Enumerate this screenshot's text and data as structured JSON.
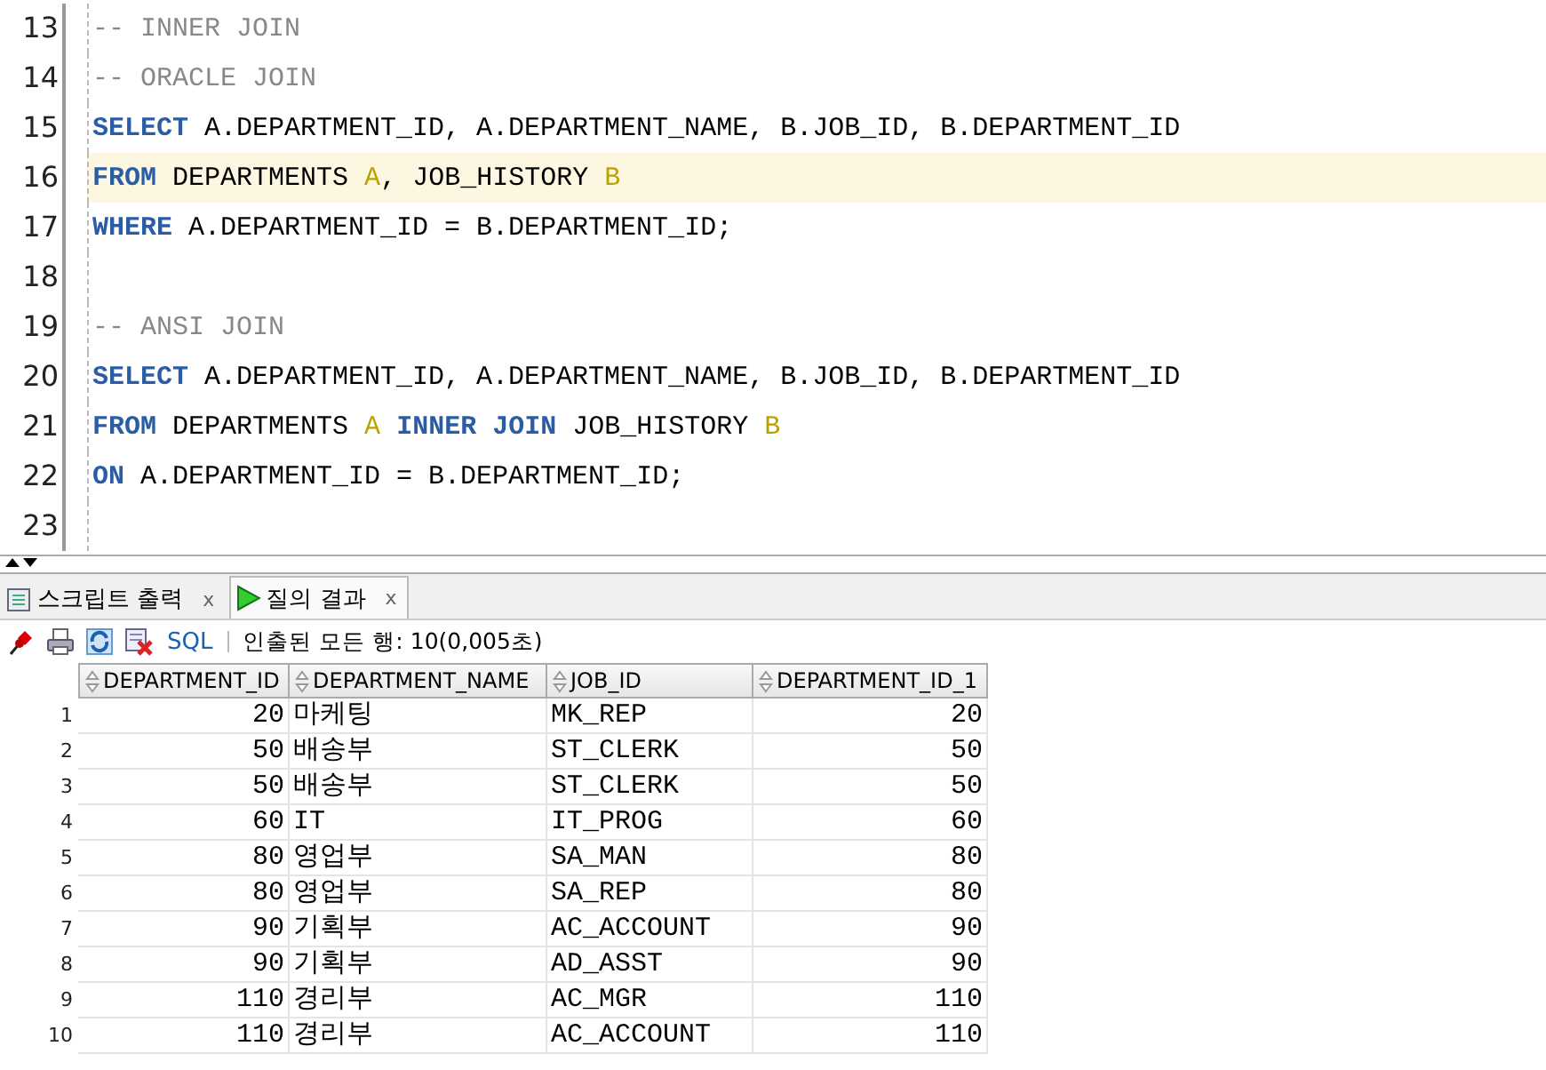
{
  "editor": {
    "lines": [
      {
        "number": "13",
        "current": false,
        "tokens": [
          {
            "kind": "comment",
            "text": "-- INNER JOIN"
          }
        ]
      },
      {
        "number": "14",
        "current": false,
        "tokens": [
          {
            "kind": "comment",
            "text": "-- ORACLE JOIN"
          }
        ]
      },
      {
        "number": "15",
        "current": false,
        "tokens": [
          {
            "kind": "keyword",
            "text": "SELECT"
          },
          {
            "kind": "plain",
            "text": " A.DEPARTMENT_ID, A.DEPARTMENT_NAME, B.JOB_ID, B.DEPARTMENT_ID"
          }
        ]
      },
      {
        "number": "16",
        "current": true,
        "tokens": [
          {
            "kind": "keyword",
            "text": "FROM"
          },
          {
            "kind": "plain",
            "text": " DEPARTMENTS "
          },
          {
            "kind": "alias",
            "text": "A"
          },
          {
            "kind": "plain",
            "text": ", JOB_HISTORY "
          },
          {
            "kind": "alias",
            "text": "B"
          }
        ]
      },
      {
        "number": "17",
        "current": false,
        "tokens": [
          {
            "kind": "keyword",
            "text": "WHERE"
          },
          {
            "kind": "plain",
            "text": " A.DEPARTMENT_ID = B.DEPARTMENT_ID;"
          }
        ]
      },
      {
        "number": "18",
        "current": false
      },
      {
        "number": "19",
        "current": false,
        "tokens": [
          {
            "kind": "comment",
            "text": "-- ANSI JOIN"
          }
        ]
      },
      {
        "number": "20",
        "current": false,
        "tokens": [
          {
            "kind": "keyword",
            "text": "SELECT"
          },
          {
            "kind": "plain",
            "text": " A.DEPARTMENT_ID, A.DEPARTMENT_NAME, B.JOB_ID, B.DEPARTMENT_ID"
          }
        ]
      },
      {
        "number": "21",
        "current": false,
        "tokens": [
          {
            "kind": "keyword",
            "text": "FROM"
          },
          {
            "kind": "plain",
            "text": " DEPARTMENTS "
          },
          {
            "kind": "alias",
            "text": "A"
          },
          {
            "kind": "keyword",
            "text": " INNER JOIN"
          },
          {
            "kind": "plain",
            "text": " JOB_HISTORY "
          },
          {
            "kind": "alias",
            "text": "B"
          }
        ]
      },
      {
        "number": "22",
        "current": false,
        "tokens": [
          {
            "kind": "keyword",
            "text": "ON"
          },
          {
            "kind": "plain",
            "text": " A.DEPARTMENT_ID = B.DEPARTMENT_ID;"
          }
        ]
      },
      {
        "number": "23",
        "current": false
      }
    ]
  },
  "tabs": [
    {
      "label": "스크립트 출력",
      "selected": false,
      "close": "x"
    },
    {
      "label": "질의 결과",
      "selected": true,
      "close": "x"
    }
  ],
  "toolbar": {
    "sql_link": "SQL",
    "status": "인출된 모든 행: 10(0,005초)"
  },
  "grid": {
    "columns": [
      {
        "label": "DEPARTMENT_ID",
        "kind": "number"
      },
      {
        "label": "DEPARTMENT_NAME",
        "kind": "text"
      },
      {
        "label": "JOB_ID",
        "kind": "text"
      },
      {
        "label": "DEPARTMENT_ID_1",
        "kind": "number"
      }
    ],
    "rows": [
      {
        "number": "1",
        "cells": [
          "20",
          "마케팅",
          "MK_REP",
          "20"
        ]
      },
      {
        "number": "2",
        "cells": [
          "50",
          "배송부",
          "ST_CLERK",
          "50"
        ]
      },
      {
        "number": "3",
        "cells": [
          "50",
          "배송부",
          "ST_CLERK",
          "50"
        ]
      },
      {
        "number": "4",
        "cells": [
          "60",
          "IT",
          "IT_PROG",
          "60"
        ]
      },
      {
        "number": "5",
        "cells": [
          "80",
          "영업부",
          "SA_MAN",
          "80"
        ]
      },
      {
        "number": "6",
        "cells": [
          "80",
          "영업부",
          "SA_REP",
          "80"
        ]
      },
      {
        "number": "7",
        "cells": [
          "90",
          "기획부",
          "AC_ACCOUNT",
          "90"
        ]
      },
      {
        "number": "8",
        "cells": [
          "90",
          "기획부",
          "AD_ASST",
          "90"
        ]
      },
      {
        "number": "9",
        "cells": [
          "110",
          "경리부",
          "AC_MGR",
          "110"
        ]
      },
      {
        "number": "10",
        "cells": [
          "110",
          "경리부",
          "AC_ACCOUNT",
          "110"
        ]
      }
    ]
  }
}
